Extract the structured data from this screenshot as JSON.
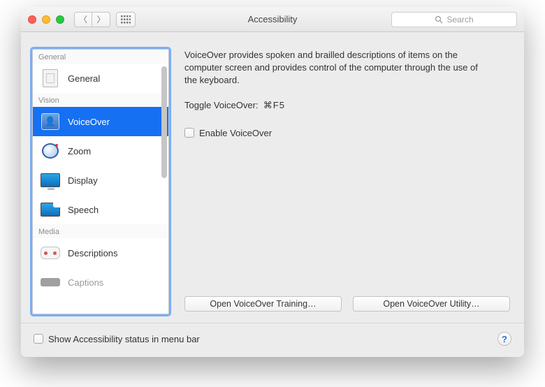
{
  "titlebar": {
    "title": "Accessibility",
    "search_placeholder": "Search"
  },
  "sidebar": {
    "sections": [
      {
        "header": "General",
        "items": [
          {
            "label": "General",
            "icon": "general"
          }
        ]
      },
      {
        "header": "Vision",
        "items": [
          {
            "label": "VoiceOver",
            "icon": "voiceover",
            "selected": true
          },
          {
            "label": "Zoom",
            "icon": "zoom"
          },
          {
            "label": "Display",
            "icon": "display"
          },
          {
            "label": "Speech",
            "icon": "speech"
          }
        ]
      },
      {
        "header": "Media",
        "items": [
          {
            "label": "Descriptions",
            "icon": "descriptions"
          },
          {
            "label": "Captions",
            "icon": "captions"
          }
        ]
      }
    ]
  },
  "main": {
    "description": "VoiceOver provides spoken and brailled descriptions of items on the computer screen and provides control of the computer through the use of the keyboard.",
    "toggle_label": "Toggle VoiceOver:",
    "toggle_shortcut": "⌘F5",
    "enable_label": "Enable VoiceOver",
    "btn_training": "Open VoiceOver Training…",
    "btn_utility": "Open VoiceOver Utility…"
  },
  "footer": {
    "show_status_label": "Show Accessibility status in menu bar",
    "help": "?"
  }
}
